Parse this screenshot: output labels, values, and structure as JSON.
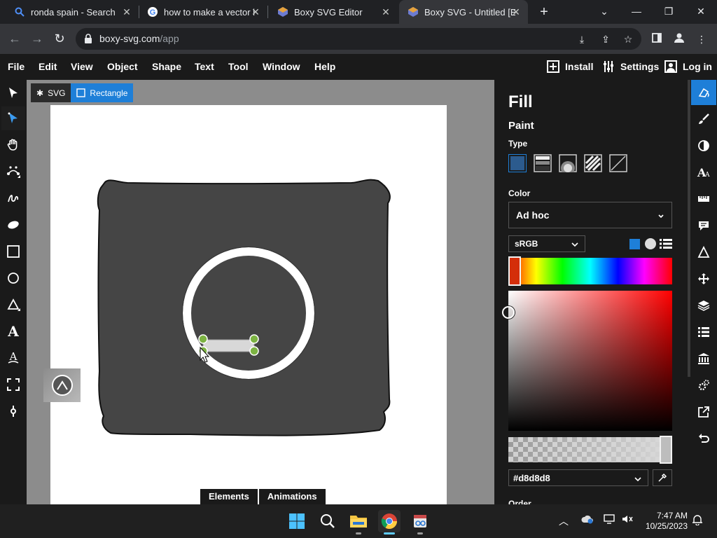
{
  "browser": {
    "tabs": [
      {
        "title": "ronda spain - Search",
        "icon": "bing-search-icon"
      },
      {
        "title": "how to make a vector i",
        "icon": "google-icon"
      },
      {
        "title": "Boxy SVG Editor",
        "icon": "boxy-svg-icon"
      },
      {
        "title": "Boxy SVG - Untitled [Ed",
        "icon": "boxy-svg-icon",
        "active": true
      }
    ],
    "url_host": "boxy-svg.com",
    "url_path": "/app"
  },
  "menubar": {
    "items": [
      "File",
      "Edit",
      "View",
      "Object",
      "Shape",
      "Text",
      "Tool",
      "Window",
      "Help"
    ],
    "install": "Install",
    "settings": "Settings",
    "login": "Log in"
  },
  "breadcrumb": {
    "svg": "SVG",
    "rect": "Rectangle"
  },
  "bottom_tabs": {
    "elements": "Elements",
    "animations": "Animations"
  },
  "panel": {
    "title": "Fill",
    "paint": "Paint",
    "type_label": "Type",
    "color_label": "Color",
    "color_mode": "Ad hoc",
    "color_space": "sRGB",
    "hex_value": "#d8d8d8",
    "order_label": "Order",
    "colors": {
      "accent": "#1e7fd8",
      "hue_handle": "#d42e0a",
      "fill": "#d8d8d8"
    }
  },
  "taskbar": {
    "time": "7:47 AM",
    "date": "10/25/2023"
  }
}
